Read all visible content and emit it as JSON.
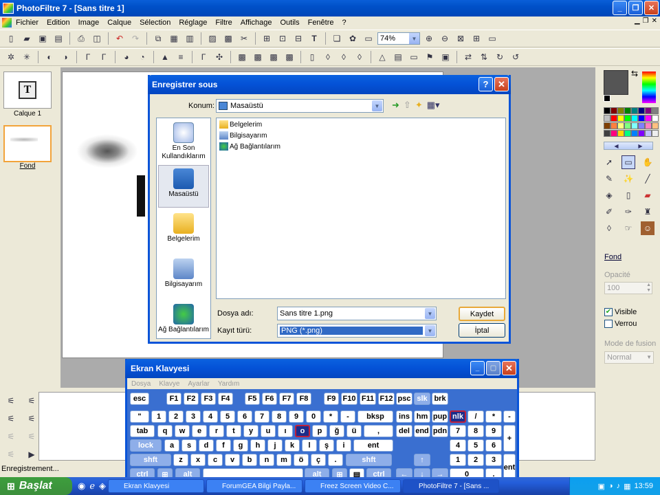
{
  "app": {
    "title": "PhotoFiltre 7 - [Sans titre 1]"
  },
  "menu": [
    "Fichier",
    "Edition",
    "Image",
    "Calque",
    "Sélection",
    "Réglage",
    "Filtre",
    "Affichage",
    "Outils",
    "Fenêtre",
    "?"
  ],
  "toolbar": {
    "zoom": "74%"
  },
  "layers": {
    "layer1": "Calque 1",
    "background": "Fond"
  },
  "right_panel": {
    "layer_name": "Fond",
    "opacity_label": "Opacité",
    "opacity_value": "100",
    "visible_label": "Visible",
    "visible_checked": true,
    "lock_label": "Verrou",
    "lock_checked": false,
    "blend_label": "Mode de fusion",
    "blend_value": "Normal"
  },
  "dialog": {
    "title": "Enregistrer sous",
    "location_label": "Konum:",
    "location_value": "Masaüstü",
    "places": [
      "En Son Kullandıklarım",
      "Masaüstü",
      "Belgelerim",
      "Bilgisayarım",
      "Ağ Bağlantılarım"
    ],
    "files": [
      "Belgelerim",
      "Bilgisayarım",
      "Ağ Bağlantılarım"
    ],
    "filename_label": "Dosya adı:",
    "filename_value": "Sans titre 1.png",
    "filetype_label": "Kayıt türü:",
    "filetype_value": "PNG (*.png)",
    "save_button": "Kaydet",
    "cancel_button": "İptal"
  },
  "keyboard": {
    "title": "Ekran Klavyesi",
    "menu": [
      "Dosya",
      "Klavye",
      "Ayarlar",
      "Yardım"
    ]
  },
  "status": "Enregistrement...",
  "taskbar": {
    "start": "Başlat",
    "tasks": [
      "Ekran Klavyesi",
      "ForumGEA Bilgi Payla...",
      "Freez Screen Video C...",
      "PhotoFiltre 7 - [Sans ..."
    ],
    "clock": "13:59"
  }
}
